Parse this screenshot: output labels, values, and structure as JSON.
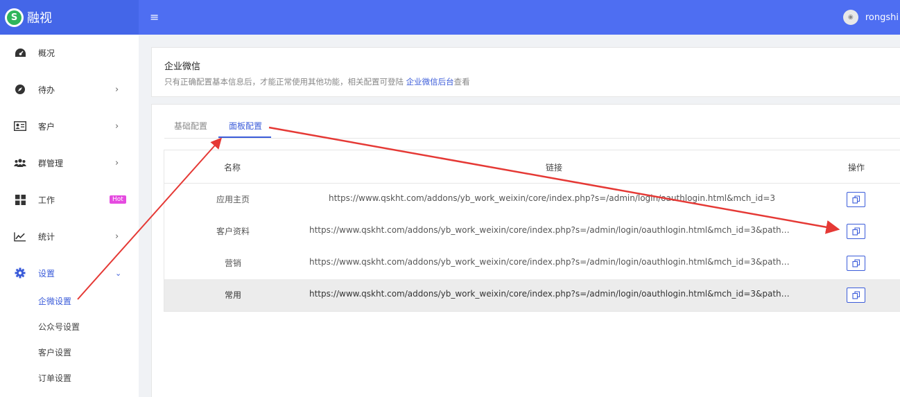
{
  "header": {
    "logo_glyph": "S",
    "brand": "融视",
    "menu_icon": "≡",
    "username": "rongshi"
  },
  "sidebar": {
    "items": [
      {
        "label": "概况",
        "icon": "dashboard-icon"
      },
      {
        "label": "待办",
        "icon": "compass-icon"
      },
      {
        "label": "客户",
        "icon": "id-card-icon"
      },
      {
        "label": "群管理",
        "icon": "users-icon"
      },
      {
        "label": "工作",
        "icon": "grid-icon",
        "badge": "Hot"
      },
      {
        "label": "统计",
        "icon": "line-chart-icon"
      },
      {
        "label": "设置",
        "icon": "gear-icon"
      }
    ],
    "sub_items": [
      "企微设置",
      "公众号设置",
      "客户设置",
      "订单设置"
    ],
    "arrow": "›",
    "arrow_down": "⌄"
  },
  "info": {
    "title": "企业微信",
    "desc_before": "只有正确配置基本信息后，才能正常使用其他功能，相关配置可登陆 ",
    "desc_link": "企业微信后台",
    "desc_after": "查看"
  },
  "tabs": [
    "基础配置",
    "面板配置"
  ],
  "table": {
    "headers": {
      "name": "名称",
      "link": "链接",
      "action": "操作"
    },
    "rows": [
      {
        "name": "应用主页",
        "link": "https://www.qskht.com/addons/yb_work_weixin/core/index.php?s=/admin/login/oauthlogin.html&mch_id=3"
      },
      {
        "name": "客户资料",
        "link": "https://www.qskht.com/addons/yb_work_weixin/core/index.php?s=/admin/login/oauthlogin.html&mch_id=3&path=..."
      },
      {
        "name": "营销",
        "link": "https://www.qskht.com/addons/yb_work_weixin/core/index.php?s=/admin/login/oauthlogin.html&mch_id=3&path=..."
      },
      {
        "name": "常用",
        "link": "https://www.qskht.com/addons/yb_work_weixin/core/index.php?s=/admin/login/oauthlogin.html&mch_id=3&path=..."
      }
    ]
  },
  "colors": {
    "primary": "#4e6ef2",
    "accent": "#3a5bd9",
    "annotation": "#e53935",
    "hot": "#e54be0"
  }
}
